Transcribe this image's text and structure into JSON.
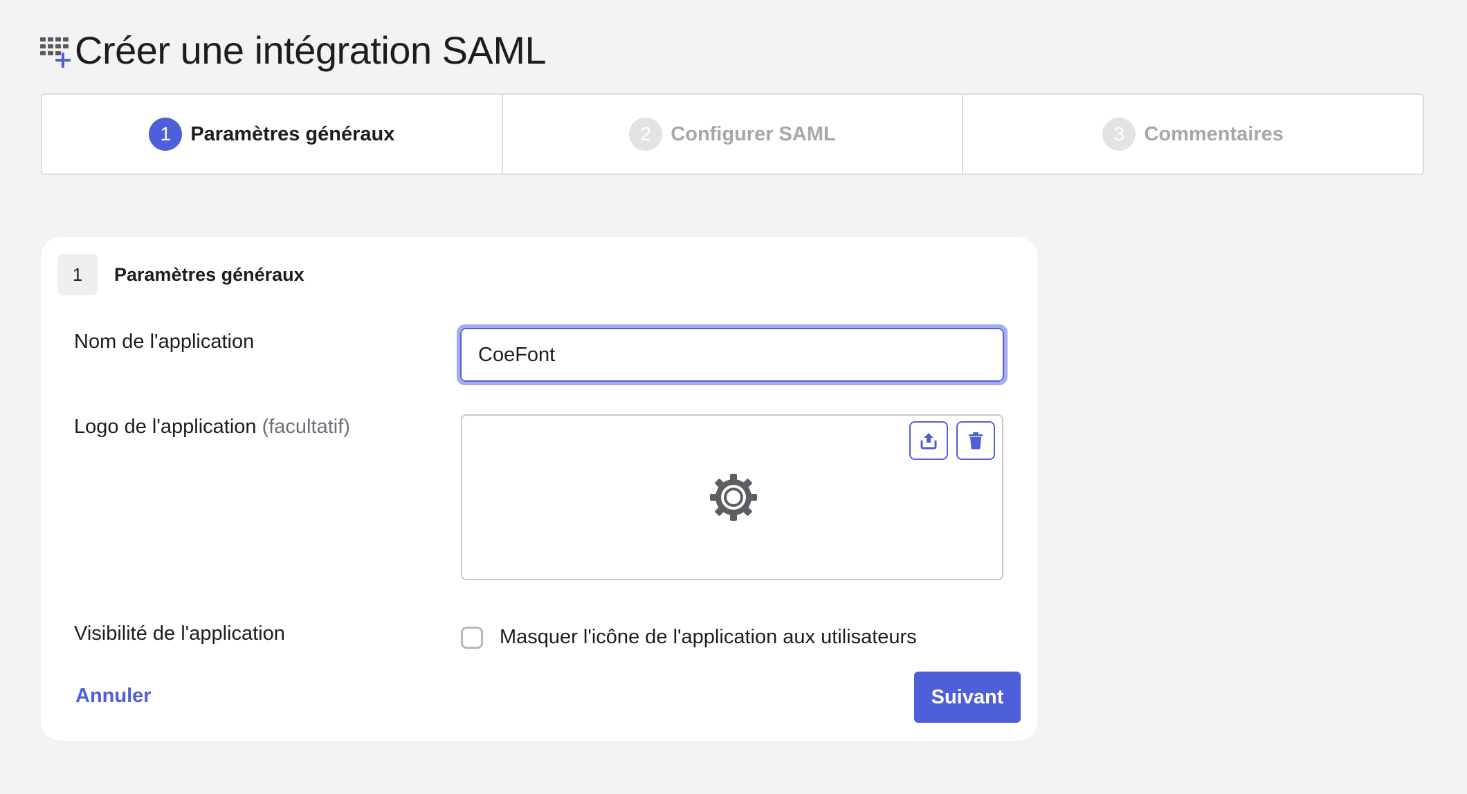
{
  "page": {
    "title": "Créer une intégration SAML",
    "title_icon": "app-add-icon"
  },
  "stepper": {
    "steps": [
      {
        "number": "1",
        "label": "Paramètres généraux",
        "state": "active"
      },
      {
        "number": "2",
        "label": "Configurer SAML",
        "state": "inactive"
      },
      {
        "number": "3",
        "label": "Commentaires",
        "state": "inactive"
      }
    ]
  },
  "card": {
    "step_number": "1",
    "title": "Paramètres généraux",
    "app_name": {
      "label": "Nom de l'application",
      "value": "CoeFont"
    },
    "app_logo": {
      "label": "Logo de l'application",
      "optional": "(facultatif)",
      "upload_icon": "upload-icon",
      "delete_icon": "trash-icon",
      "placeholder_icon": "gear-icon"
    },
    "visibility": {
      "label": "Visibilité de l'application",
      "checkbox_label": "Masquer l'icône de l'application aux utilisateurs",
      "checked": false
    },
    "cancel_label": "Annuler",
    "next_label": "Suivant"
  },
  "colors": {
    "accent": "#4f5fd9",
    "background": "#f3f3f3",
    "inactive_step": "#a6a6ab"
  }
}
